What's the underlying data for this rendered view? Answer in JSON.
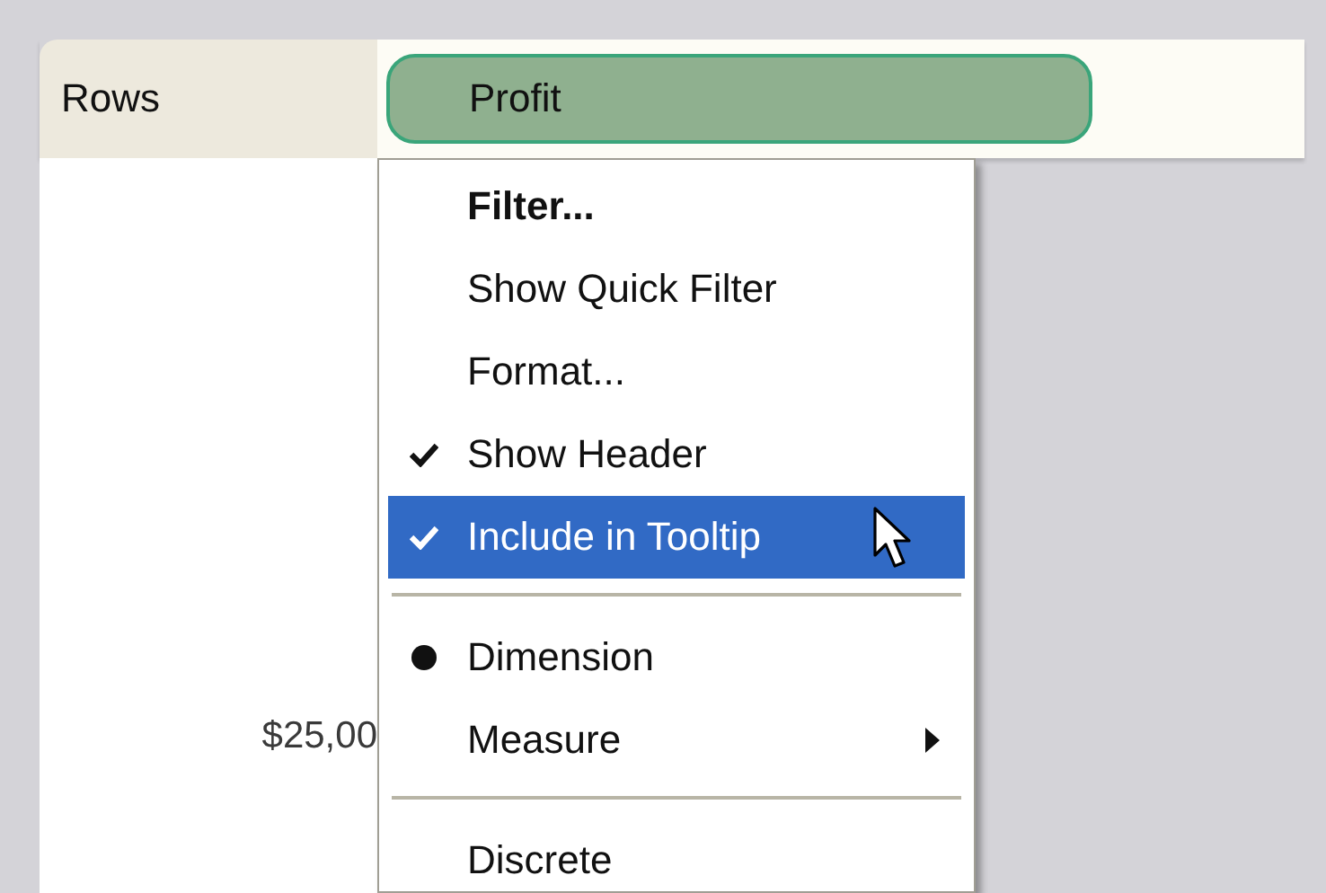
{
  "shelf": {
    "label": "Rows",
    "pill": {
      "label": "Profit"
    }
  },
  "axis_label": "$25,00",
  "context_menu": {
    "items": [
      {
        "kind": "command",
        "label": "Filter...",
        "bold": true,
        "selected": false
      },
      {
        "kind": "command",
        "label": "Show Quick Filter",
        "bold": false,
        "selected": false
      },
      {
        "kind": "command",
        "label": "Format...",
        "bold": false,
        "selected": false
      },
      {
        "kind": "check",
        "label": "Show Header",
        "bold": false,
        "checked": true,
        "selected": false
      },
      {
        "kind": "check",
        "label": "Include in Tooltip",
        "bold": false,
        "checked": true,
        "selected": true
      },
      {
        "kind": "separator"
      },
      {
        "kind": "radio",
        "label": "Dimension",
        "bold": false,
        "checked": true,
        "selected": false
      },
      {
        "kind": "submenu",
        "label": "Measure",
        "bold": false,
        "selected": false
      },
      {
        "kind": "separator"
      },
      {
        "kind": "radio",
        "label": "Discrete",
        "bold": false,
        "checked": false,
        "selected": false
      }
    ]
  }
}
